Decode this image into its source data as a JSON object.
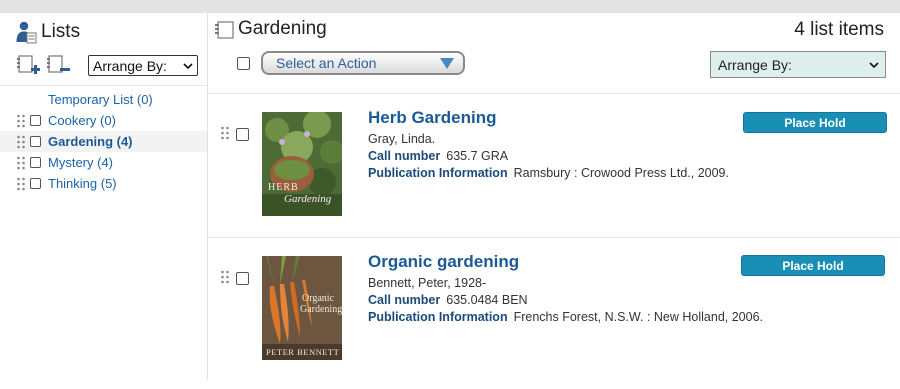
{
  "sidebar": {
    "title": "Lists",
    "arrange_label": "Arrange By:",
    "items": [
      {
        "label": "Temporary List (0)",
        "active": false,
        "has_grip": false,
        "has_checkbox": false
      },
      {
        "label": "Cookery (0)",
        "active": false,
        "has_grip": true,
        "has_checkbox": true
      },
      {
        "label": "Gardening (4)",
        "active": true,
        "has_grip": true,
        "has_checkbox": true
      },
      {
        "label": "Mystery (4)",
        "active": false,
        "has_grip": true,
        "has_checkbox": true
      },
      {
        "label": "Thinking (5)",
        "active": false,
        "has_grip": true,
        "has_checkbox": true
      }
    ]
  },
  "main": {
    "title": "Gardening",
    "count_label": "4 list items",
    "action_label": "Select an Action",
    "arrange_label": "Arrange By:",
    "items": [
      {
        "title": "Herb Gardening",
        "author": "Gray, Linda.",
        "call_number_key": "Call number",
        "call_number": "635.7 GRA",
        "pub_key": "Publication Information",
        "pub_info": "Ramsbury : Crowood Press Ltd., 2009.",
        "button": "Place Hold",
        "cover_text_1": "HERB",
        "cover_text_2": "Gardening"
      },
      {
        "title": "Organic gardening",
        "author": "Bennett, Peter, 1928-",
        "call_number_key": "Call number",
        "call_number": "635.0484 BEN",
        "pub_key": "Publication Information",
        "pub_info": "Frenchs Forest, N.S.W. : New Holland, 2006.",
        "button": "Place Hold",
        "cover_text_1": "Organic",
        "cover_text_2": "Gardening",
        "cover_text_3": "PETER BENNETT"
      }
    ]
  },
  "colors": {
    "link": "#1a63a8",
    "button": "#1a8fb5",
    "arrange_bg": "#dcefed"
  },
  "icons": [
    "person-list-icon",
    "add-list-icon",
    "remove-list-icon",
    "drag-grip-icon",
    "list-icon",
    "chevron-down-icon"
  ]
}
